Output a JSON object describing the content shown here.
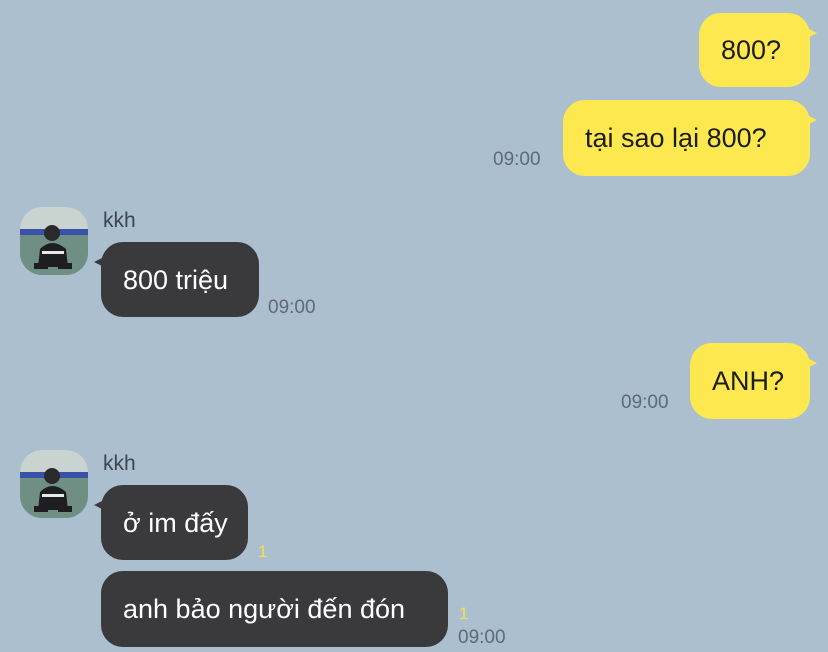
{
  "theme": {
    "background": "#abbfcf",
    "outgoing_bubble": "#fde94f",
    "incoming_bubble": "#3a3a3c",
    "unread_color": "#f2e34d"
  },
  "messages": [
    {
      "direction": "outgoing",
      "text": "800?"
    },
    {
      "direction": "outgoing",
      "text": "tại sao lại 800?",
      "time": "09:00"
    },
    {
      "direction": "incoming",
      "sender": "kkh",
      "avatar": "profile-photo-avatar",
      "text": "800 triệu",
      "time": "09:00"
    },
    {
      "direction": "outgoing",
      "text": "ANH?",
      "time": "09:00"
    },
    {
      "direction": "incoming",
      "sender": "kkh",
      "avatar": "profile-photo-avatar",
      "text": "ở im đấy",
      "unread": "1"
    },
    {
      "direction": "incoming",
      "text": "anh bảo người đến đón",
      "unread": "1",
      "time": "09:00"
    }
  ]
}
